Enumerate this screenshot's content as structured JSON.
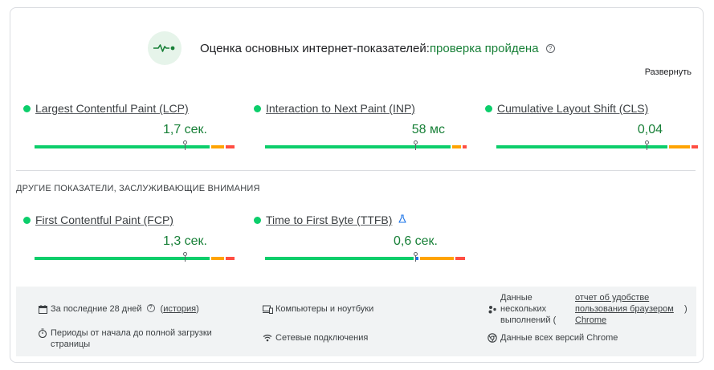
{
  "header": {
    "title": "Оценка основных интернет-показателей:",
    "status": "проверка пройдена",
    "help_glyph": "?"
  },
  "expand_label": "Развернуть",
  "core_metrics": [
    {
      "name": "Largest Contentful Paint (LCP)",
      "value": "1,7 сек.",
      "status_color": "#0cce6b"
    },
    {
      "name": "Interaction to Next Paint (INP)",
      "value": "58 мс",
      "status_color": "#0cce6b"
    },
    {
      "name": "Cumulative Layout Shift (CLS)",
      "value": "0,04",
      "status_color": "#0cce6b"
    }
  ],
  "other_section_title": "ДРУГИЕ ПОКАЗАТЕЛИ, ЗАСЛУЖИВАЮЩИЕ ВНИМАНИЯ",
  "other_metrics": [
    {
      "name": "First Contentful Paint (FCP)",
      "value": "1,3 сек.",
      "status_color": "#0cce6b"
    },
    {
      "name": "Time to First Byte (TTFB)",
      "value": "0,6 сек.",
      "status_color": "#0cce6b",
      "experimental_icon": "flask-icon"
    }
  ],
  "footer": {
    "period_label": "За последние 28 дней",
    "history_open": "(",
    "history_link": "история",
    "history_close": ")",
    "load_periods": "Периоды от начала до полной загрузки страницы",
    "devices": "Компьютеры и ноутбуки",
    "network": "Сетевые подключения",
    "data_sources_line1": "Данные",
    "data_sources_line2": "нескольких",
    "data_sources_line3": "выполнений (",
    "report_link": "отчет об удобстве пользования браузером Chrome",
    "data_sources_close": ")",
    "chrome_versions": "Данные всех версий Chrome"
  },
  "colors": {
    "good": "#0cce6b",
    "needs_improvement": "#ffa400",
    "poor": "#ff4e42",
    "pass_text": "#188038"
  }
}
